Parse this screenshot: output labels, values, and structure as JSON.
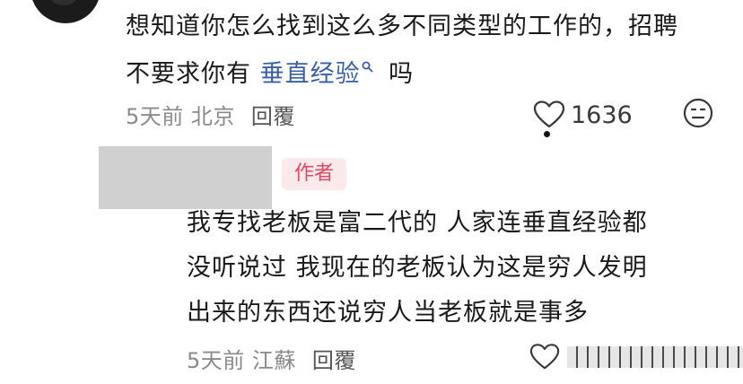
{
  "comment": {
    "text_before": "想知道你怎么找到这么多不同类型的工作的，招聘不要求你有 ",
    "keyword": "垂直经验",
    "text_after": " 吗",
    "time": "5天前",
    "location": "北京",
    "reply_label": "回覆",
    "like_count": "1636"
  },
  "reply": {
    "badge": "作者",
    "text": "我专找老板是富二代的 人家连垂直经验都\n没听说过 我现在的老板认为这是穷人发明\n出来的东西还说穷人当老板就是事多",
    "time": "5天前",
    "location": "江蘇",
    "reply_label": "回覆"
  },
  "icons": {
    "like": "heart-outline-icon",
    "dislike": "meh-face-icon",
    "search": "search-icon"
  },
  "colors": {
    "keyword": "#3b5fa6",
    "badge_text": "#e0485f",
    "badge_bg": "#fbe9ec",
    "meta": "#8a8a8a"
  }
}
